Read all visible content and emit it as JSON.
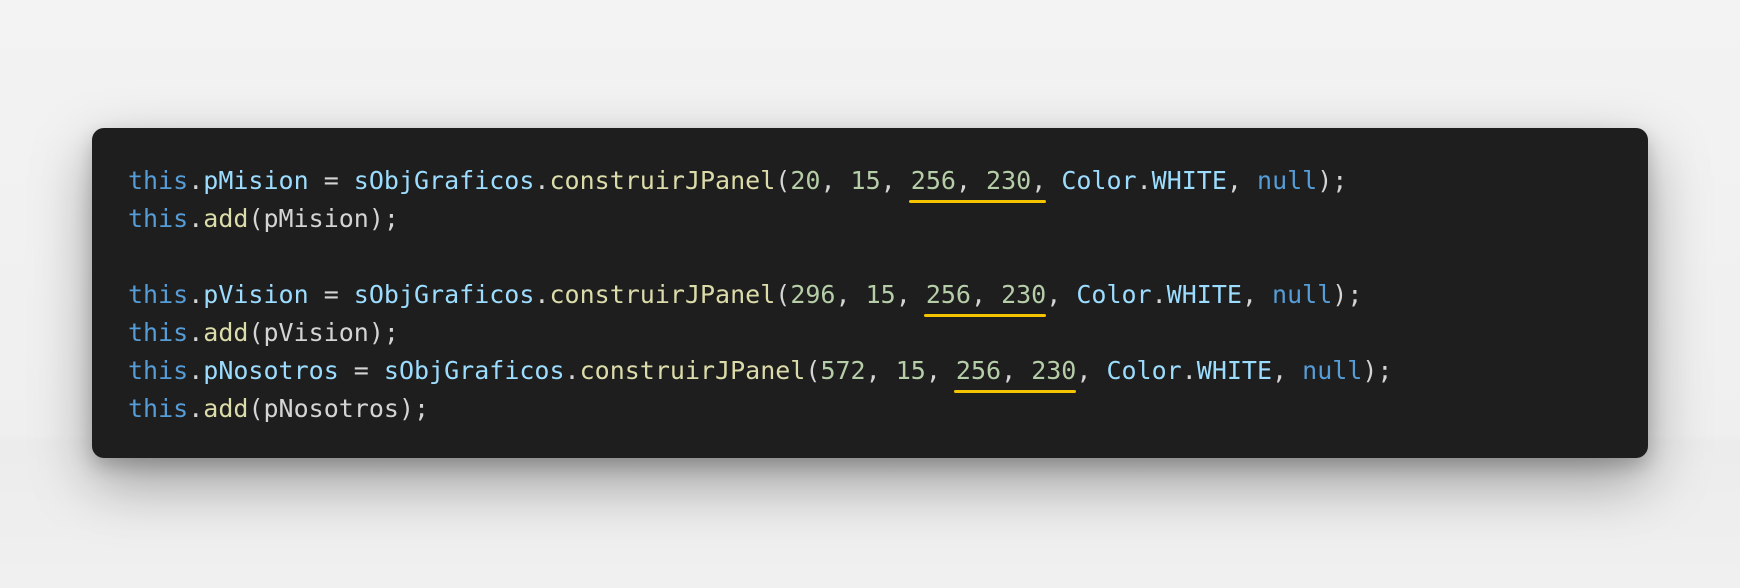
{
  "code": {
    "lines": [
      [
        {
          "t": "this",
          "c": "kw"
        },
        {
          "t": ".",
          "c": "pun"
        },
        {
          "t": "pMision",
          "c": "prop"
        },
        {
          "t": " = ",
          "c": "pun"
        },
        {
          "t": "sObjGraficos",
          "c": "prop"
        },
        {
          "t": ".",
          "c": "pun"
        },
        {
          "t": "construirJPanel",
          "c": "fn"
        },
        {
          "t": "(",
          "c": "pun"
        },
        {
          "t": "20",
          "c": "num"
        },
        {
          "t": ", ",
          "c": "pun"
        },
        {
          "t": "15",
          "c": "num"
        },
        {
          "t": ", ",
          "c": "pun"
        },
        {
          "hl": true,
          "parts": [
            {
              "t": "256",
              "c": "num"
            },
            {
              "t": ", ",
              "c": "pun"
            },
            {
              "t": "230",
              "c": "num"
            },
            {
              "t": ",",
              "c": "pun"
            }
          ]
        },
        {
          "t": " ",
          "c": "pun"
        },
        {
          "t": "Color",
          "c": "prop"
        },
        {
          "t": ".",
          "c": "pun"
        },
        {
          "t": "WHITE",
          "c": "prop"
        },
        {
          "t": ", ",
          "c": "pun"
        },
        {
          "t": "null",
          "c": "kw"
        },
        {
          "t": ");",
          "c": "pun"
        }
      ],
      [
        {
          "t": "this",
          "c": "kw"
        },
        {
          "t": ".",
          "c": "pun"
        },
        {
          "t": "add",
          "c": "fn"
        },
        {
          "t": "(pMision);",
          "c": "pun"
        }
      ],
      [],
      [
        {
          "t": "this",
          "c": "kw"
        },
        {
          "t": ".",
          "c": "pun"
        },
        {
          "t": "pVision",
          "c": "prop"
        },
        {
          "t": " = ",
          "c": "pun"
        },
        {
          "t": "sObjGraficos",
          "c": "prop"
        },
        {
          "t": ".",
          "c": "pun"
        },
        {
          "t": "construirJPanel",
          "c": "fn"
        },
        {
          "t": "(",
          "c": "pun"
        },
        {
          "t": "296",
          "c": "num"
        },
        {
          "t": ", ",
          "c": "pun"
        },
        {
          "t": "15",
          "c": "num"
        },
        {
          "t": ", ",
          "c": "pun"
        },
        {
          "hl": true,
          "parts": [
            {
              "t": "256",
              "c": "num"
            },
            {
              "t": ", ",
              "c": "pun"
            },
            {
              "t": "230",
              "c": "num"
            }
          ]
        },
        {
          "t": ", ",
          "c": "pun"
        },
        {
          "t": "Color",
          "c": "prop"
        },
        {
          "t": ".",
          "c": "pun"
        },
        {
          "t": "WHITE",
          "c": "prop"
        },
        {
          "t": ", ",
          "c": "pun"
        },
        {
          "t": "null",
          "c": "kw"
        },
        {
          "t": ");",
          "c": "pun"
        }
      ],
      [
        {
          "t": "this",
          "c": "kw"
        },
        {
          "t": ".",
          "c": "pun"
        },
        {
          "t": "add",
          "c": "fn"
        },
        {
          "t": "(pVision);",
          "c": "pun"
        }
      ],
      [
        {
          "t": "this",
          "c": "kw"
        },
        {
          "t": ".",
          "c": "pun"
        },
        {
          "t": "pNosotros",
          "c": "prop"
        },
        {
          "t": " = ",
          "c": "pun"
        },
        {
          "t": "sObjGraficos",
          "c": "prop"
        },
        {
          "t": ".",
          "c": "pun"
        },
        {
          "t": "construirJPanel",
          "c": "fn"
        },
        {
          "t": "(",
          "c": "pun"
        },
        {
          "t": "572",
          "c": "num"
        },
        {
          "t": ", ",
          "c": "pun"
        },
        {
          "t": "15",
          "c": "num"
        },
        {
          "t": ", ",
          "c": "pun"
        },
        {
          "hl": true,
          "parts": [
            {
              "t": "256",
              "c": "num"
            },
            {
              "t": ", ",
              "c": "pun"
            },
            {
              "t": "230",
              "c": "num"
            }
          ]
        },
        {
          "t": ", ",
          "c": "pun"
        },
        {
          "t": "Color",
          "c": "prop"
        },
        {
          "t": ".",
          "c": "pun"
        },
        {
          "t": "WHITE",
          "c": "prop"
        },
        {
          "t": ", ",
          "c": "pun"
        },
        {
          "t": "null",
          "c": "kw"
        },
        {
          "t": ");",
          "c": "pun"
        }
      ],
      [
        {
          "t": "this",
          "c": "kw"
        },
        {
          "t": ".",
          "c": "pun"
        },
        {
          "t": "add",
          "c": "fn"
        },
        {
          "t": "(pNosotros);",
          "c": "pun"
        }
      ]
    ]
  },
  "colors": {
    "keyword": "#569cd6",
    "property": "#9cdcfe",
    "function": "#dcdcaa",
    "number": "#b5cea8",
    "punctuation": "#d4d4d4",
    "highlight_underline": "#f5c400",
    "panel_background": "#1e1e1e"
  }
}
